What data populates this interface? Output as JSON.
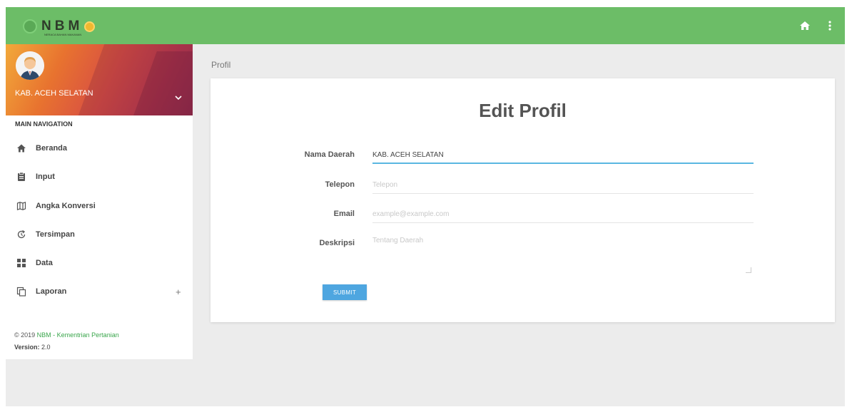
{
  "header": {
    "logo_text": "NBM",
    "logo_subtext": "NERACA BAHAN MAKANAN",
    "accent_color": "#6cbd67",
    "icons": [
      "home-icon",
      "more-vert-icon"
    ]
  },
  "user": {
    "name": "KAB. ACEH SELATAN"
  },
  "sidebar": {
    "nav_header": "MAIN NAVIGATION",
    "items": [
      {
        "label": "Beranda",
        "icon": "home-icon"
      },
      {
        "label": "Input",
        "icon": "clipboard-icon"
      },
      {
        "label": "Angka Konversi",
        "icon": "map-icon"
      },
      {
        "label": "Tersimpan",
        "icon": "refresh-icon"
      },
      {
        "label": "Data",
        "icon": "dashboard-icon"
      },
      {
        "label": "Laporan",
        "icon": "copy-icon",
        "expand": "+"
      }
    ],
    "footer": {
      "copyright_prefix": "© 2019 ",
      "copyright_link": "NBM - Kementrian Pertanian",
      "version_label": "Version:",
      "version_value": " 2.0"
    }
  },
  "main": {
    "breadcrumb": "Profil",
    "title": "Edit Profil",
    "form": {
      "nama_daerah": {
        "label": "Nama Daerah",
        "value": "KAB. ACEH SELATAN"
      },
      "telepon": {
        "label": "Telepon",
        "placeholder": "Telepon"
      },
      "email": {
        "label": "Email",
        "placeholder": "example@example.com"
      },
      "deskripsi": {
        "label": "Deskripsi",
        "placeholder": "Tentang Daerah"
      },
      "submit_label": "SUBMIT"
    }
  }
}
